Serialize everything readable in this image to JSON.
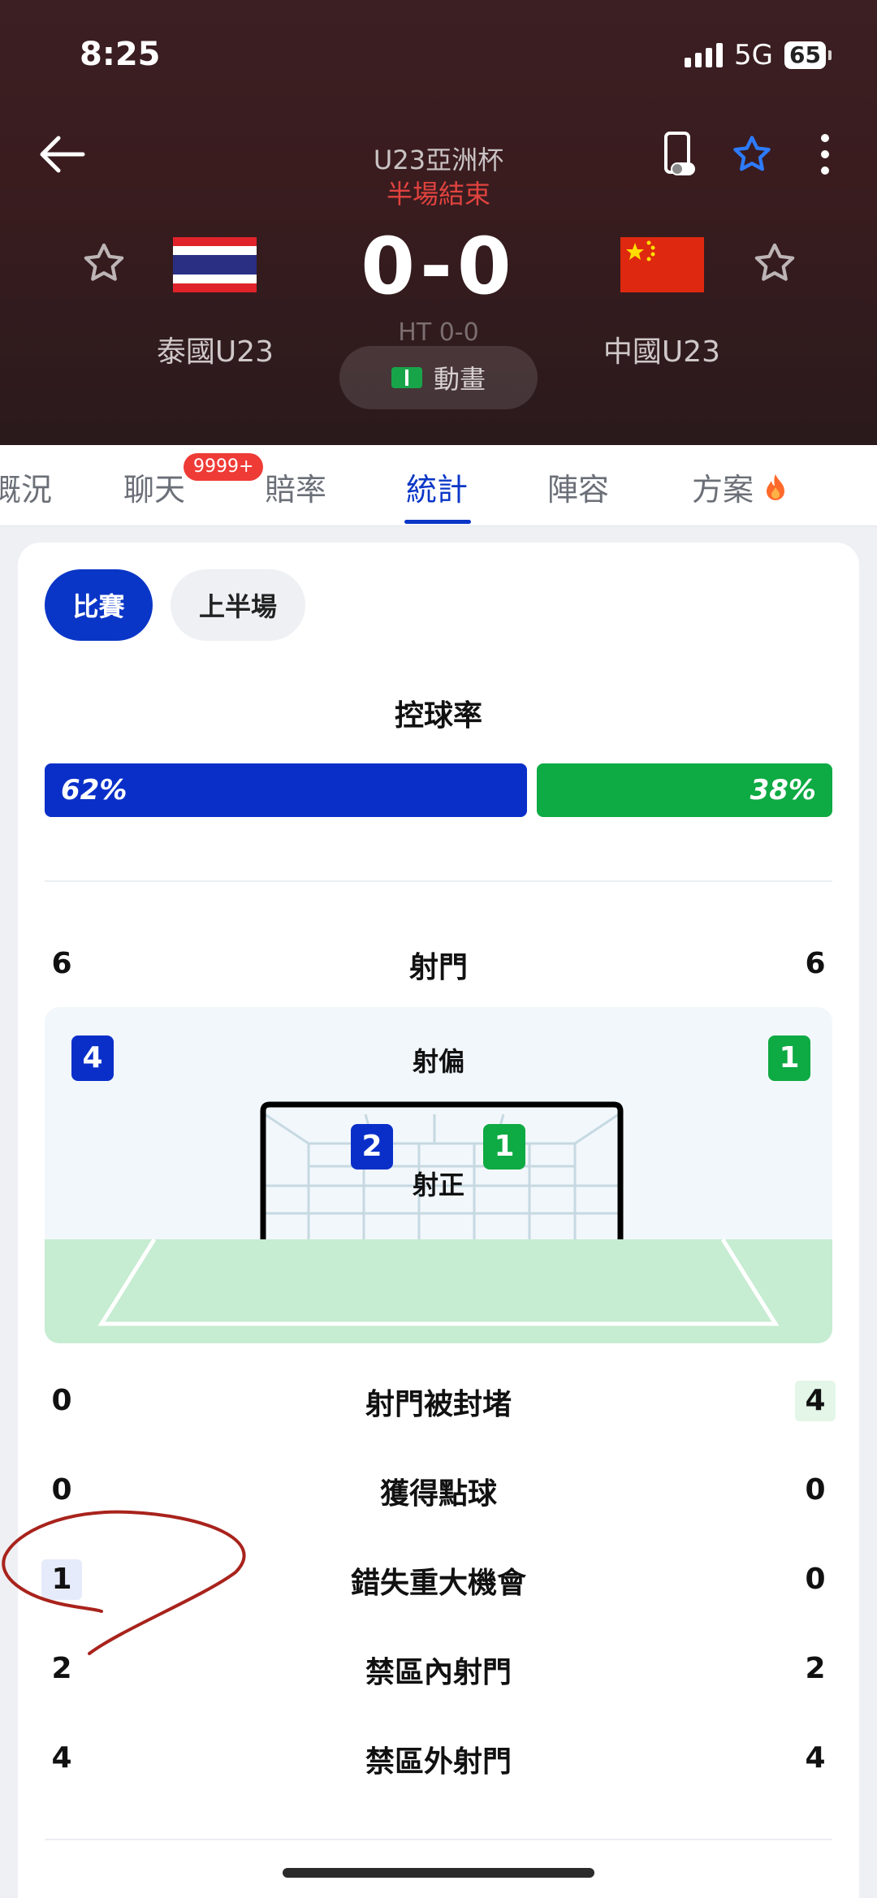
{
  "status_bar": {
    "time": "8:25",
    "network": "5G",
    "battery": "65"
  },
  "header": {
    "league": "U23亞洲杯",
    "period": "半場結束",
    "home_team": "泰國U23",
    "away_team": "中國U23",
    "score": "0-0",
    "halftime": "HT 0-0",
    "animation_label": "動畫"
  },
  "tabs": [
    {
      "label": "概況"
    },
    {
      "label": "聊天",
      "badge": "9999+"
    },
    {
      "label": "賠率"
    },
    {
      "label": "統計"
    },
    {
      "label": "陣容"
    },
    {
      "label": "方案"
    }
  ],
  "filters": [
    "比賽",
    "上半場"
  ],
  "possession": {
    "title": "控球率",
    "home": "62%",
    "away": "38%",
    "home_value": 62,
    "away_value": 38
  },
  "shots": {
    "label": "射門",
    "home": "6",
    "away": "6",
    "off_target": {
      "label": "射偏",
      "home": "4",
      "away": "1"
    },
    "on_target": {
      "label": "射正",
      "home": "2",
      "away": "1"
    }
  },
  "stats": [
    {
      "label": "射門被封堵",
      "home": "0",
      "away": "4"
    },
    {
      "label": "獲得點球",
      "home": "0",
      "away": "0"
    },
    {
      "label": "錯失重大機會",
      "home": "1",
      "away": "0"
    },
    {
      "label": "禁區內射門",
      "home": "2",
      "away": "2"
    },
    {
      "label": "禁區外射門",
      "home": "4",
      "away": "4"
    }
  ],
  "colors": {
    "home": "#0a2fc9",
    "away": "#0eaa43",
    "accent": "#0a36c7",
    "period": "#e1433f"
  }
}
